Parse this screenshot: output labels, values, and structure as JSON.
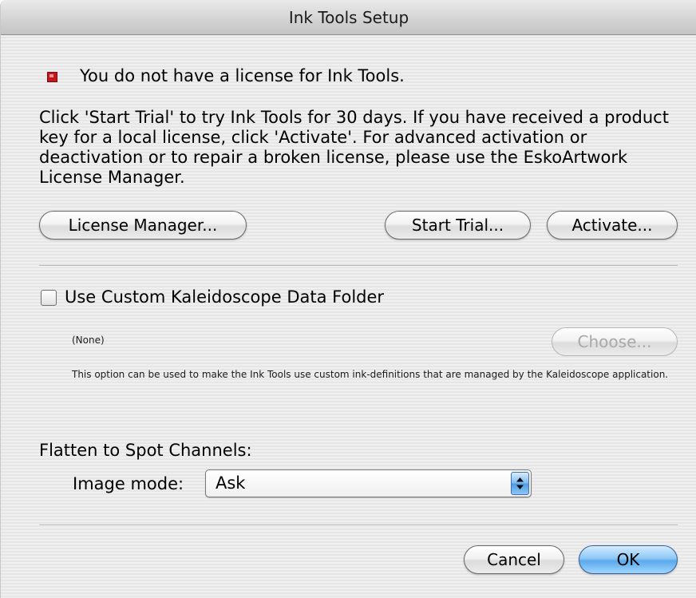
{
  "window": {
    "title": "Ink Tools Setup"
  },
  "license": {
    "icon": "warning-icon",
    "status_text": "You do not have a license for Ink Tools.",
    "description": "Click 'Start Trial' to try Ink Tools for 30 days. If you have received a product key for a local license, click 'Activate'. For advanced activation or deactivation or to repair a broken license, please use the EskoArtwork License Manager.",
    "license_manager_label": "License Manager...",
    "start_trial_label": "Start Trial...",
    "activate_label": "Activate..."
  },
  "kaleidoscope": {
    "checkbox_label": "Use Custom Kaleidoscope Data Folder",
    "checked": false,
    "folder_path": "(None)",
    "choose_label": "Choose...",
    "choose_enabled": false,
    "help_text": "This option can be used to make the Ink Tools use custom ink-definitions that are managed by the Kaleidoscope application."
  },
  "flatten": {
    "heading": "Flatten to Spot Channels:",
    "image_mode_label": "Image mode:",
    "image_mode_value": "Ask"
  },
  "footer": {
    "cancel_label": "Cancel",
    "ok_label": "OK"
  },
  "colors": {
    "warning": "#c4161c",
    "default_button": "#5aa9ec"
  }
}
